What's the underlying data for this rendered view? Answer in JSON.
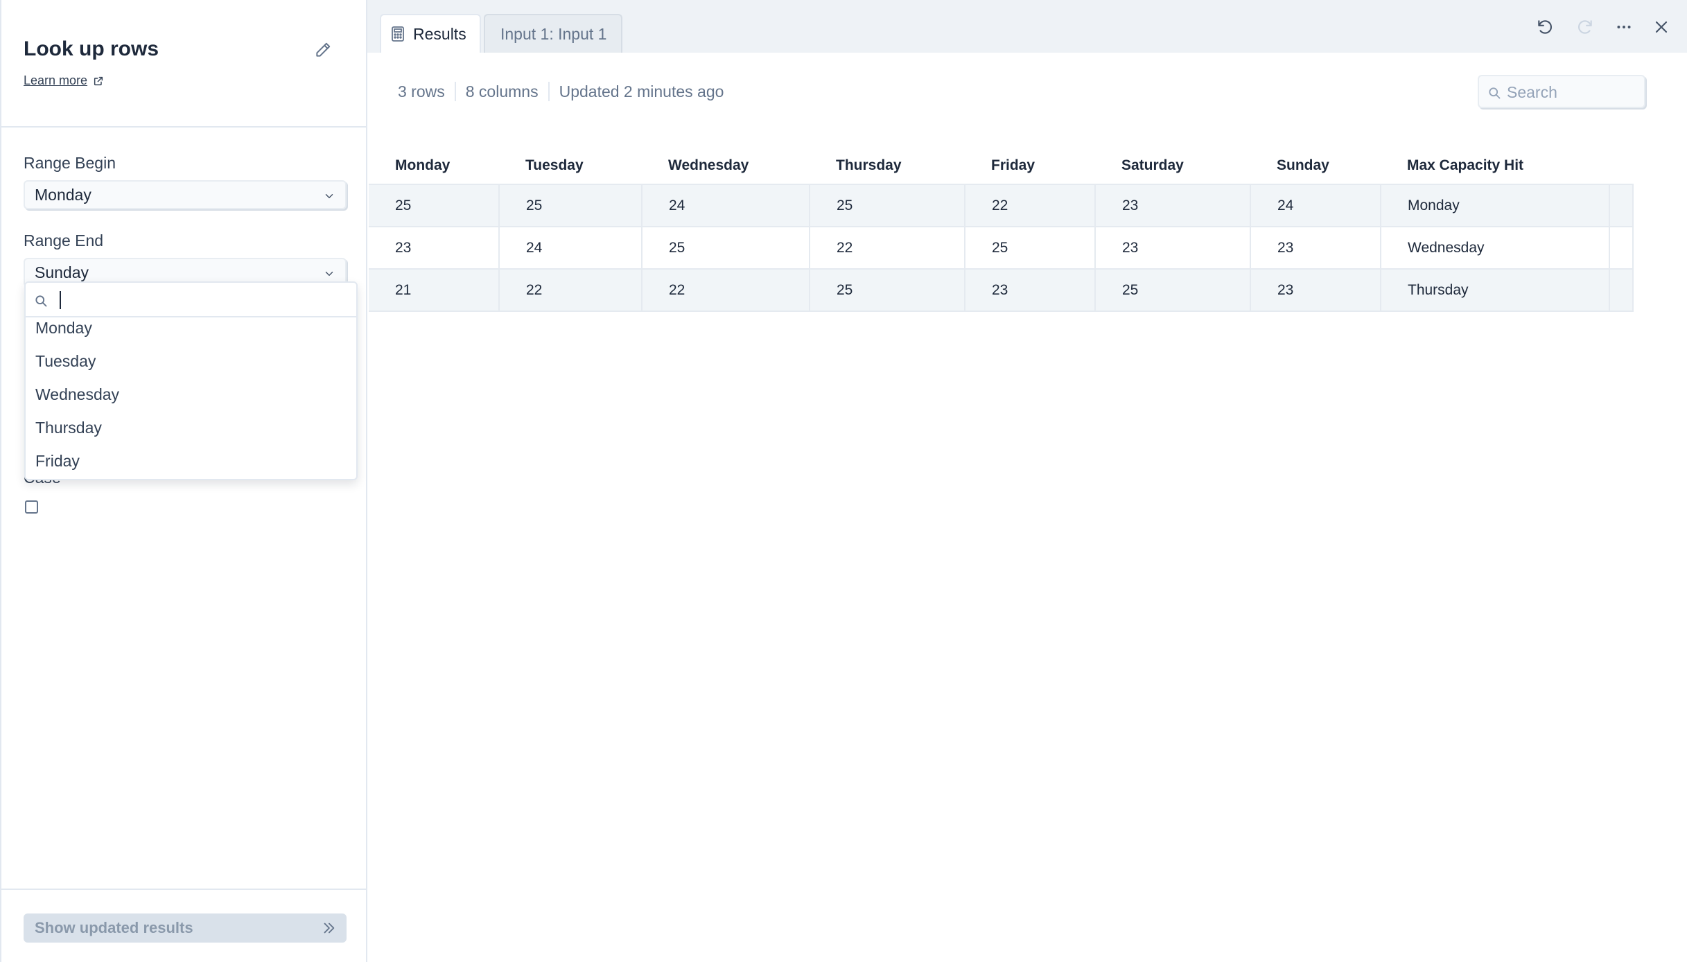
{
  "panel": {
    "title": "Look up rows",
    "learn_more": "Learn more",
    "range_begin_label": "Range Begin",
    "range_begin_value": "Monday",
    "range_end_label": "Range End",
    "range_end_value": "Sunday",
    "dropdown": {
      "search_value": "",
      "options": [
        "Monday",
        "Tuesday",
        "Wednesday",
        "Thursday",
        "Friday"
      ]
    },
    "case_label": "Case",
    "case_checked": false,
    "show_button": "Show updated results"
  },
  "tabs": [
    {
      "label": "Results",
      "active": true
    },
    {
      "label": "Input 1: Input 1",
      "active": false
    }
  ],
  "meta": {
    "rows": "3 rows",
    "columns": "8 columns",
    "updated": "Updated 2 minutes ago"
  },
  "search": {
    "placeholder": "Search"
  },
  "table": {
    "headers": [
      "Monday",
      "Tuesday",
      "Wednesday",
      "Thursday",
      "Friday",
      "Saturday",
      "Sunday",
      "Max Capacity Hit"
    ],
    "rows": [
      [
        "25",
        "25",
        "24",
        "25",
        "22",
        "23",
        "24",
        "Monday"
      ],
      [
        "23",
        "24",
        "25",
        "22",
        "25",
        "23",
        "23",
        "Wednesday"
      ],
      [
        "21",
        "22",
        "22",
        "25",
        "23",
        "25",
        "23",
        "Thursday"
      ]
    ]
  },
  "icons": {
    "edit": "pencil-icon",
    "external": "external-link-icon",
    "chevron": "chevron-down-icon",
    "search": "search-icon",
    "calculator": "calculator-icon",
    "undo": "undo-icon",
    "redo": "redo-icon",
    "more": "more-horizontal-icon",
    "close": "close-icon",
    "forward": "double-chevron-right-icon"
  },
  "colors": {
    "text": "#1e293b",
    "muted": "#64748b",
    "border": "#e2e8f0",
    "row_stripe": "#f1f5f8",
    "button_disabled": "#d9e1ea"
  }
}
